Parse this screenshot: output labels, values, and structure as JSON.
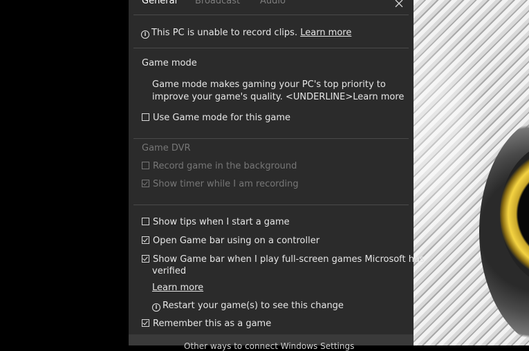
{
  "tabs": [
    {
      "label": "General",
      "active": true
    },
    {
      "label": "Broadcast",
      "active": false
    },
    {
      "label": "Audio",
      "active": false
    }
  ],
  "notice": {
    "text": "This PC is unable to record clips. ",
    "link": "Learn more",
    "icon": "info-icon"
  },
  "game_mode": {
    "heading": "Game mode",
    "desc_line1": "Game mode makes gaming your PC's top priority to",
    "desc_line2": "improve your game's quality. <UNDERLINE>Learn more",
    "checkbox": {
      "label": "Use Game mode for this game",
      "checked": false
    }
  },
  "game_dvr": {
    "heading": "Game DVR",
    "options": [
      {
        "label": "Record game in the background",
        "checked": false
      },
      {
        "label": "Show timer while I am recording",
        "checked": true
      }
    ]
  },
  "general_options": [
    {
      "label": "Show tips when I start a game",
      "checked": false
    },
    {
      "label": "Open Game bar using  on a controller",
      "checked": true
    },
    {
      "label_line1": "Show Game bar when I play full-screen games Microsoft has",
      "label_line2": "verified",
      "checked": true
    }
  ],
  "learn_more": "Learn more",
  "restart_notice": "Restart your game(s) to see this change",
  "remember": {
    "label": "Remember this as a game",
    "checked": true
  },
  "bottom_button": "Other ways to connect Windows Settings",
  "colors": {
    "panel_bg": "#2b2b2b",
    "text": "#e6e6e6",
    "disabled": "#777777",
    "accent_ring": "#f4d342"
  }
}
